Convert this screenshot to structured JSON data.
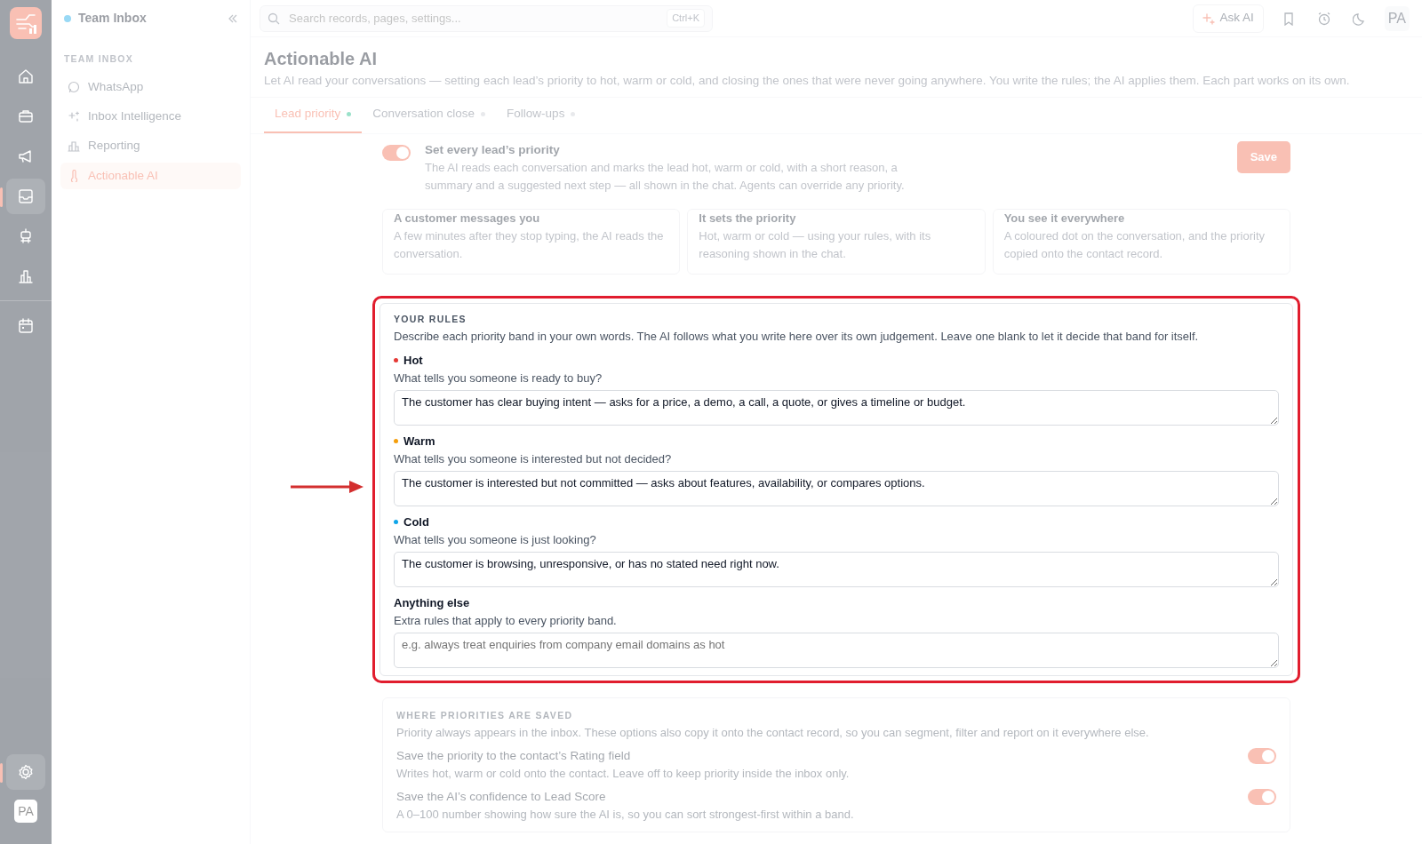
{
  "rail": {
    "items": [
      {
        "selected": false
      },
      {
        "selected": false
      },
      {
        "selected": false
      },
      {
        "selected": true
      },
      {
        "selected": false
      },
      {
        "selected": false
      },
      {
        "selected": false
      }
    ],
    "footer": [
      {
        "selected": true
      }
    ],
    "avatar": "PA"
  },
  "sidebar": {
    "title": "Team Inbox",
    "section": "TEAM INBOX",
    "items": [
      {
        "label": "WhatsApp",
        "selected": false
      },
      {
        "label": "Inbox Intelligence",
        "selected": false
      },
      {
        "label": "Reporting",
        "selected": false
      },
      {
        "label": "Actionable AI",
        "selected": true
      }
    ]
  },
  "topbar": {
    "search": {
      "placeholder": "Search records, pages, settings...",
      "shortcut": "Ctrl+K"
    },
    "ask_ai": "Ask AI",
    "avatar": "PA"
  },
  "page": {
    "title": "Actionable AI",
    "subtitle": "Let AI read your conversations — setting each lead’s priority to hot, warm or cold, and closing the ones that were never going anywhere. You write the rules; the AI applies them. Each part works on its own."
  },
  "tabs": [
    {
      "label": "Lead priority",
      "selected": true,
      "on": true
    },
    {
      "label": "Conversation close",
      "selected": false,
      "on": false
    },
    {
      "label": "Follow-ups",
      "selected": false,
      "on": false
    }
  ],
  "feature": {
    "on": true,
    "title": "Set every lead’s priority",
    "description": "The AI reads each conversation and marks the lead hot, warm or cold, with a short reason, a summary and a suggested next step — all shown in the chat. Agents can override any priority.",
    "save": "Save"
  },
  "steps": [
    {
      "title": "A customer messages you",
      "text": "A few minutes after they stop typing, the AI reads the conversation."
    },
    {
      "title": "It sets the priority",
      "text": "Hot, warm or cold — using your rules, with its reasoning shown in the chat."
    },
    {
      "title": "You see it everywhere",
      "text": "A coloured dot on the conversation, and the priority copied onto the contact record."
    }
  ],
  "rules": {
    "heading": "YOUR RULES",
    "intro": "Describe each priority band in your own words. The AI follows what you write here over its own judgement. Leave one blank to let it decide that band for itself.",
    "bands": [
      {
        "label": "Hot",
        "color": "#e53935",
        "question": "What tells you someone is ready to buy?",
        "value": "The customer has clear buying intent — asks for a price, a demo, a call, a quote, or gives a timeline or budget."
      },
      {
        "label": "Warm",
        "color": "#f59e0b",
        "question": "What tells you someone is interested but not decided?",
        "value": "The customer is interested but not committed — asks about features, availability, or compares options."
      },
      {
        "label": "Cold",
        "color": "#0ea5e9",
        "question": "What tells you someone is just looking?",
        "value": "The customer is browsing, unresponsive, or has no stated need right now."
      },
      {
        "label": "Anything else",
        "question": "Extra rules that apply to every priority band.",
        "placeholder": "e.g. always treat enquiries from company email domains as hot"
      }
    ]
  },
  "storage": {
    "heading": "WHERE PRIORITIES ARE SAVED",
    "intro": "Priority always appears in the inbox. These options also copy it onto the contact record, so you can segment, filter and report on it everywhere else.",
    "options": [
      {
        "title": "Save the priority to the contact’s Rating field",
        "text": "Writes hot, warm or cold onto the contact. Leave off to keep priority inside the inbox only.",
        "on": true
      },
      {
        "title": "Save the AI’s confidence to Lead Score",
        "text": "A 0–100 number showing how sure the AI is, so you can sort strongest-first within a band.",
        "on": true
      }
    ]
  }
}
